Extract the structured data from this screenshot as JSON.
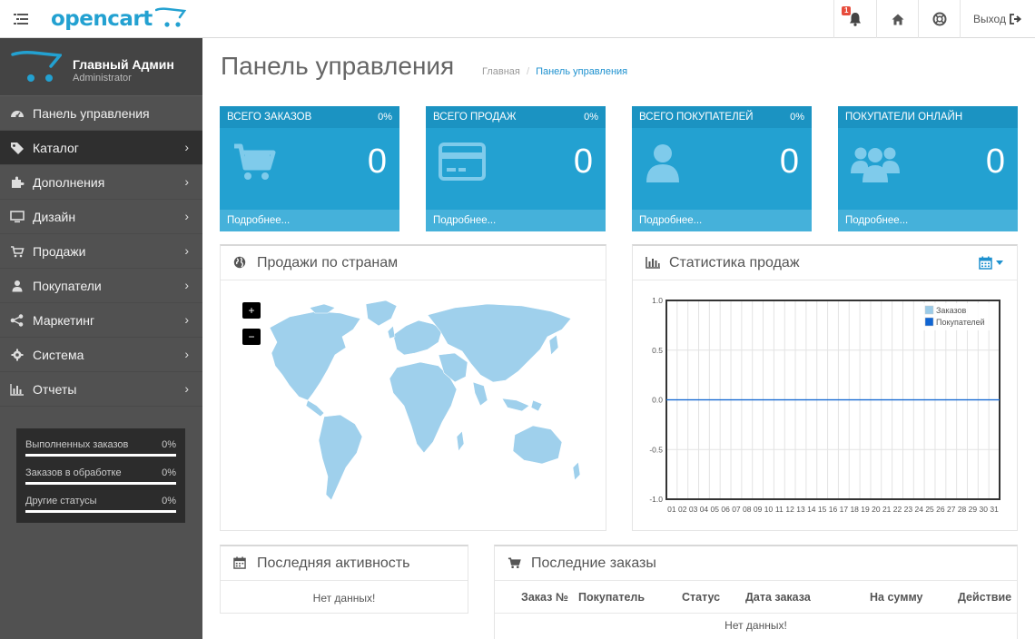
{
  "header": {
    "logo_text": "opencart",
    "notification_count": "1",
    "logout_label": "Выход"
  },
  "sidebar": {
    "profile_name": "Главный Админ",
    "profile_role": "Administrator",
    "items": [
      {
        "label": "Панель управления",
        "icon": "dashboard-icon",
        "has_chevron": false,
        "active": false
      },
      {
        "label": "Каталог",
        "icon": "tag-icon",
        "has_chevron": true,
        "active": true
      },
      {
        "label": "Дополнения",
        "icon": "puzzle-icon",
        "has_chevron": true,
        "active": false
      },
      {
        "label": "Дизайн",
        "icon": "monitor-icon",
        "has_chevron": true,
        "active": false
      },
      {
        "label": "Продажи",
        "icon": "cart-icon",
        "has_chevron": true,
        "active": false
      },
      {
        "label": "Покупатели",
        "icon": "user-icon",
        "has_chevron": true,
        "active": false
      },
      {
        "label": "Маркетинг",
        "icon": "share-icon",
        "has_chevron": true,
        "active": false
      },
      {
        "label": "Система",
        "icon": "gear-icon",
        "has_chevron": true,
        "active": false
      },
      {
        "label": "Отчеты",
        "icon": "bar-chart-icon",
        "has_chevron": true,
        "active": false
      }
    ],
    "stats": [
      {
        "label": "Выполненных заказов",
        "value": "0%"
      },
      {
        "label": "Заказов в обработке",
        "value": "0%"
      },
      {
        "label": "Другие статусы",
        "value": "0%"
      }
    ]
  },
  "page": {
    "title": "Панель управления",
    "breadcrumb_home": "Главная",
    "breadcrumb_separator": "/",
    "breadcrumb_current": "Панель управления"
  },
  "tiles": [
    {
      "title": "ВСЕГО ЗАКАЗОВ",
      "percent": "0%",
      "value": "0",
      "more": "Подробнее...",
      "icon": "cart-icon"
    },
    {
      "title": "ВСЕГО ПРОДАЖ",
      "percent": "0%",
      "value": "0",
      "more": "Подробнее...",
      "icon": "credit-card-icon"
    },
    {
      "title": "ВСЕГО ПОКУПАТЕЛЕЙ",
      "percent": "0%",
      "value": "0",
      "more": "Подробнее...",
      "icon": "user-icon"
    },
    {
      "title": "ПОКУПАТЕЛИ ОНЛАЙН",
      "percent": "",
      "value": "0",
      "more": "Подробнее...",
      "icon": "users-icon"
    }
  ],
  "map_panel": {
    "title": "Продажи по странам",
    "zoom_in": "+",
    "zoom_out": "−"
  },
  "chart_panel": {
    "title": "Статистика продаж"
  },
  "activity_panel": {
    "title": "Последняя активность",
    "empty": "Нет данных!"
  },
  "orders_panel": {
    "title": "Последние заказы",
    "columns": [
      "Заказ №",
      "Покупатель",
      "Статус",
      "Дата заказа",
      "На сумму",
      "Действие"
    ],
    "empty": "Нет данных!"
  },
  "chart_data": {
    "type": "line",
    "title": "",
    "xlabel": "",
    "ylabel": "",
    "x": [
      "01",
      "02",
      "03",
      "04",
      "05",
      "06",
      "07",
      "08",
      "09",
      "10",
      "11",
      "12",
      "13",
      "14",
      "15",
      "16",
      "17",
      "18",
      "19",
      "20",
      "21",
      "22",
      "23",
      "24",
      "25",
      "26",
      "27",
      "28",
      "29",
      "30",
      "31"
    ],
    "ylim": [
      -1.0,
      1.0
    ],
    "yticks": [
      "1.0",
      "0.5",
      "0.0",
      "-0.5",
      "-1.0"
    ],
    "grid": true,
    "legend_position": "top-right",
    "series": [
      {
        "name": "Заказов",
        "color": "#9bcbe8",
        "values": [
          0,
          0,
          0,
          0,
          0,
          0,
          0,
          0,
          0,
          0,
          0,
          0,
          0,
          0,
          0,
          0,
          0,
          0,
          0,
          0,
          0,
          0,
          0,
          0,
          0,
          0,
          0,
          0,
          0,
          0,
          0
        ]
      },
      {
        "name": "Покупателей",
        "color": "#1065d2",
        "values": [
          0,
          0,
          0,
          0,
          0,
          0,
          0,
          0,
          0,
          0,
          0,
          0,
          0,
          0,
          0,
          0,
          0,
          0,
          0,
          0,
          0,
          0,
          0,
          0,
          0,
          0,
          0,
          0,
          0,
          0,
          0
        ]
      }
    ]
  },
  "colors": {
    "tile_blue": "#23a1d1",
    "sidebar_bg": "#515151",
    "accent": "#1e91cf"
  }
}
